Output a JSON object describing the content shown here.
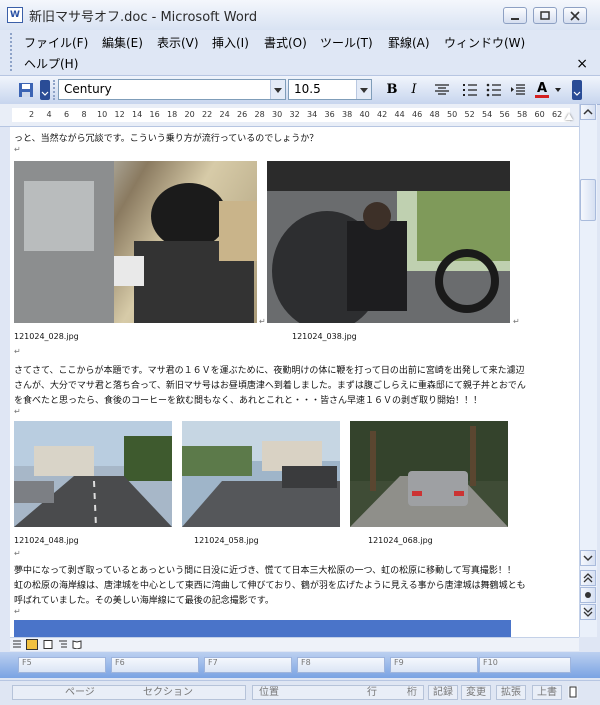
{
  "window": {
    "title": "新旧マサ号オフ.doc - Microsoft Word",
    "app_icon_letter": "W"
  },
  "menu": {
    "items": [
      "ファイル(F)",
      "編集(E)",
      "表示(V)",
      "挿入(I)",
      "書式(O)",
      "ツール(T)",
      "罫線(A)",
      "ウィンドウ(W)",
      "ヘルプ(H)"
    ],
    "close_glyph": "×"
  },
  "toolbar": {
    "font_name": "Century",
    "font_size": "10.5",
    "bold": "B",
    "italic": "I",
    "font_color_glyph": "A",
    "font_color": "#d42020"
  },
  "ruler": {
    "numbers": [
      "2",
      "4",
      "6",
      "8",
      "10",
      "12",
      "14",
      "16",
      "18",
      "20",
      "22",
      "24",
      "26",
      "28",
      "30",
      "32",
      "34",
      "36",
      "38",
      "40",
      "42",
      "44",
      "46",
      "48",
      "50",
      "52",
      "54",
      "56",
      "58",
      "60",
      "62"
    ]
  },
  "document": {
    "line_top": "っと、当然ながら冗談です。こういう乗り方が流行っているのでしょうか？",
    "captions_row1": [
      "121024_028.jpg",
      "121024_038.jpg"
    ],
    "paragraph2": [
      "さてさて、ここからが本題です。マサ君の１６Ｖを運ぶために、夜勤明けの体に鞭を打って日の出前に宮崎を出発して来た濾辺",
      "さんが、大分でマサ君と落ち合って、新旧マサ号はお昼頃唐津へ到着しました。まずは腹ごしらえに重森邸にて親子丼とおでん",
      "を食べたと思ったら、食後のコーヒーを飲む間もなく、あれとこれと・・・皆さん早速１６Ｖの剥ぎ取り開始！！！"
    ],
    "captions_row2": [
      "121024_048.jpg",
      "121024_058.jpg",
      "121024_068.jpg"
    ],
    "paragraph3": [
      "夢中になって剥ぎ取っているとあっという間に日没に近づき、慌てて日本三大松原の一つ、虹の松原に移動して写真撮影！！",
      "虹の松原の海岸線は、唐津城を中心として東西に湾曲して伸びており、鶴が羽を広げたように見える事から唐津城は舞鶴城とも",
      "呼ばれていました。その美しい海岸線にて最後の記念撮影です。"
    ],
    "para_mark": "↵",
    "accent_bar_color": "#4a74c9"
  },
  "fkeys": [
    "F5",
    "F6",
    "F7",
    "F8",
    "F9",
    "F10"
  ],
  "status": {
    "page": "ページ",
    "section": "セクション",
    "position": "位置",
    "line": "行",
    "column": "桁",
    "record": "記録",
    "change": "変更",
    "extend": "拡張",
    "overwrite": "上書"
  }
}
